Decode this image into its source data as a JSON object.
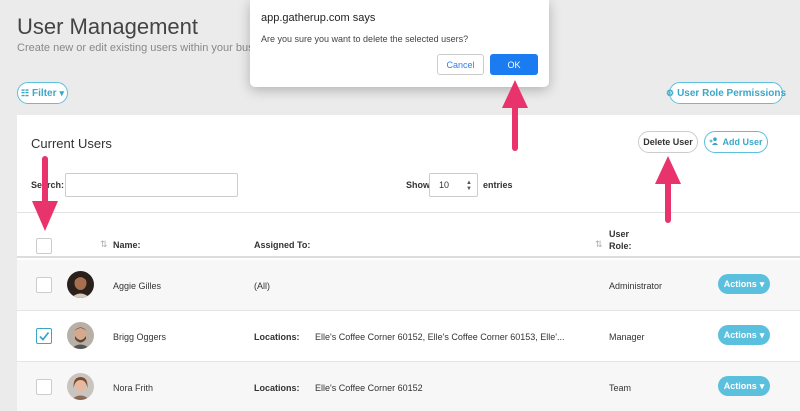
{
  "header": {
    "title": "User Management",
    "subtitle": "Create new or edit existing users within your business alone."
  },
  "toolbar": {
    "filter_label": "Filter",
    "filter_icon": "filter-icon",
    "role_permissions_label": "User Role Permissions",
    "role_permissions_icon": "gear-icon"
  },
  "panel": {
    "title": "Current Users",
    "delete_label": "Delete User",
    "add_label": "Add User",
    "add_icon": "add-user-icon",
    "search_label": "Search:",
    "search_value": "",
    "show_label": "Show",
    "entries_value": "10",
    "entries_label": "entries"
  },
  "table": {
    "columns": {
      "name": "Name:",
      "assigned": "Assigned To:",
      "role_line1": "User",
      "role_line2": "Role:"
    },
    "rows": [
      {
        "name": "Aggie Gilles",
        "assigned_label": "",
        "assigned_value": "(All)",
        "role": "Administrator",
        "checked": false,
        "action": "Actions"
      },
      {
        "name": "Brigg Oggers",
        "assigned_label": "Locations:",
        "assigned_value": "Elle's Coffee Corner 60152, Elle's Coffee Corner 60153, Elle'...",
        "role": "Manager",
        "checked": true,
        "action": "Actions"
      },
      {
        "name": "Nora Frith",
        "assigned_label": "Locations:",
        "assigned_value": "Elle's Coffee Corner 60152",
        "role": "Team",
        "checked": false,
        "action": "Actions"
      }
    ]
  },
  "dialog": {
    "title": "app.gatherup.com says",
    "message": "Are you sure you want to delete the selected users?",
    "cancel_label": "Cancel",
    "ok_label": "OK"
  },
  "colors": {
    "accent": "#5bc0de",
    "dialog_ok": "#1a7cf0",
    "annotation_arrow": "#e8336d"
  }
}
